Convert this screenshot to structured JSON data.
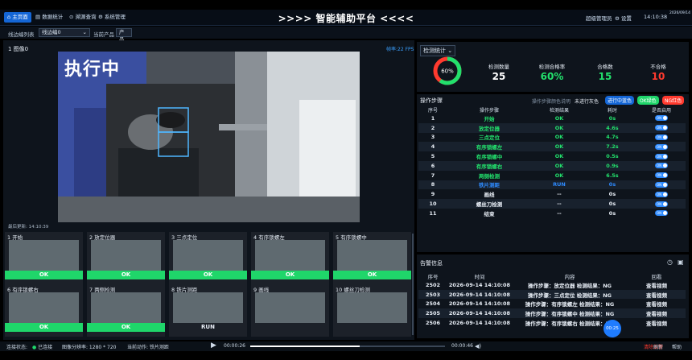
{
  "nav": {
    "tabs": [
      {
        "label": "主页面",
        "icon": "home-icon"
      },
      {
        "label": "数据统计",
        "icon": "chart-icon"
      },
      {
        "label": "溯源查询",
        "icon": "search-icon"
      },
      {
        "label": "系统管理",
        "icon": "gear-icon"
      }
    ],
    "title": ">>>> 智能辅助平台 <<<<",
    "user": "超级管理员",
    "settings": "设置",
    "time": "14:10:38",
    "date": "2026/09/14"
  },
  "subbar": {
    "line_list_label": "线边编列表",
    "line_select": "线边编0",
    "current_product_label": "当前产品",
    "current_product": "产品"
  },
  "camera": {
    "label": "1 图像0",
    "fps": "帧率:22 FPS",
    "status_overlay": "执行中",
    "last_update": "最后更新: 14:10:39"
  },
  "thumbnails": [
    {
      "title": "1 开始",
      "status": "OK"
    },
    {
      "title": "2 放定位器",
      "status": "OK"
    },
    {
      "title": "3 三点定位",
      "status": "OK"
    },
    {
      "title": "4 有序锁螺左",
      "status": "OK"
    },
    {
      "title": "5 有序锁螺中",
      "status": "OK"
    },
    {
      "title": "6 有序锁螺右",
      "status": "OK"
    },
    {
      "title": "7 两侧检测",
      "status": "OK"
    },
    {
      "title": "8 铁片测距",
      "status": "RUN"
    },
    {
      "title": "9 画线",
      "status": ""
    },
    {
      "title": "10 螺丝刀检测",
      "status": ""
    }
  ],
  "stats": {
    "title": "检测统计",
    "gauge_percent": 60,
    "gauge_text": "60%",
    "items": [
      {
        "label": "检测数量",
        "value": "25",
        "color": "#ffffff"
      },
      {
        "label": "检测合格率",
        "value": "60%",
        "color": "#22e06c"
      },
      {
        "label": "合格数",
        "value": "15",
        "color": "#22e06c"
      },
      {
        "label": "不合格",
        "value": "10",
        "color": "#ff3a2e"
      }
    ]
  },
  "steps": {
    "title": "操作步骤",
    "legend_text": "操作步骤颜色说明",
    "legend_not_run": "未进行灰色",
    "legend_running": "进行中蓝色",
    "legend_ok": "OK绿色",
    "legend_ng": "NG红色",
    "headers": [
      "序号",
      "操作步骤",
      "检测结果",
      "耗时",
      "是否启用"
    ],
    "toggle_text": "ON",
    "rows": [
      {
        "no": "1",
        "name": "开始",
        "result": "OK",
        "time": "0s",
        "state": "ok"
      },
      {
        "no": "2",
        "name": "放定位器",
        "result": "OK",
        "time": "4.6s",
        "state": "ok"
      },
      {
        "no": "3",
        "name": "三点定位",
        "result": "OK",
        "time": "4.7s",
        "state": "ok"
      },
      {
        "no": "4",
        "name": "有序锁螺左",
        "result": "OK",
        "time": "7.2s",
        "state": "ok"
      },
      {
        "no": "5",
        "name": "有序锁螺中",
        "result": "OK",
        "time": "0.5s",
        "state": "ok"
      },
      {
        "no": "6",
        "name": "有序锁螺右",
        "result": "OK",
        "time": "0.9s",
        "state": "ok"
      },
      {
        "no": "7",
        "name": "两侧检测",
        "result": "OK",
        "time": "6.5s",
        "state": "ok"
      },
      {
        "no": "8",
        "name": "铁片测距",
        "result": "RUN",
        "time": "0s",
        "state": "run"
      },
      {
        "no": "9",
        "name": "画线",
        "result": "--",
        "time": "0s",
        "state": "idle"
      },
      {
        "no": "10",
        "name": "螺丝刀检测",
        "result": "--",
        "time": "0s",
        "state": "idle"
      },
      {
        "no": "11",
        "name": "结束",
        "result": "--",
        "time": "0s",
        "state": "idle"
      }
    ]
  },
  "alarms": {
    "title": "告警信息",
    "headers": [
      "序号",
      "时间",
      "内容",
      "回看"
    ],
    "rows": [
      {
        "no": "2502",
        "time": "2026-09-14 14:10:08",
        "content": "操作步骤：放定位器 检测结果：NG",
        "action": "查看视频"
      },
      {
        "no": "2503",
        "time": "2026-09-14 14:10:08",
        "content": "操作步骤：三点定位 检测结果：NG",
        "action": "查看视频"
      },
      {
        "no": "2504",
        "time": "2026-09-14 14:10:08",
        "content": "操作步骤：有序锁螺左 检测结果：NG",
        "action": "查看视频"
      },
      {
        "no": "2505",
        "time": "2026-09-14 14:10:08",
        "content": "操作步骤：有序锁螺中 检测结果：NG",
        "action": "查看视频"
      },
      {
        "no": "2506",
        "time": "2026-09-14 14:10:08",
        "content": "操作步骤：有序锁螺右 检测结果：NG",
        "action": "查看视频"
      }
    ]
  },
  "bottom": {
    "conn_label": "连接状态:",
    "conn_value": "已连接",
    "resolution": "图像分辨率: 1280 * 720",
    "current_action": "当前动作: 铁片测距",
    "player_current": "00:00:26",
    "player_total": "00:00:46",
    "player_progress": 0.56,
    "badge": "00:25",
    "btn_alarm": "清除告警",
    "btn_refresh": "刷新",
    "btn_help": "帮助"
  },
  "colors": {
    "accent": "#1466d6",
    "ok": "#1fd66a",
    "ng": "#ff3a2e",
    "run": "#2e8bff"
  }
}
